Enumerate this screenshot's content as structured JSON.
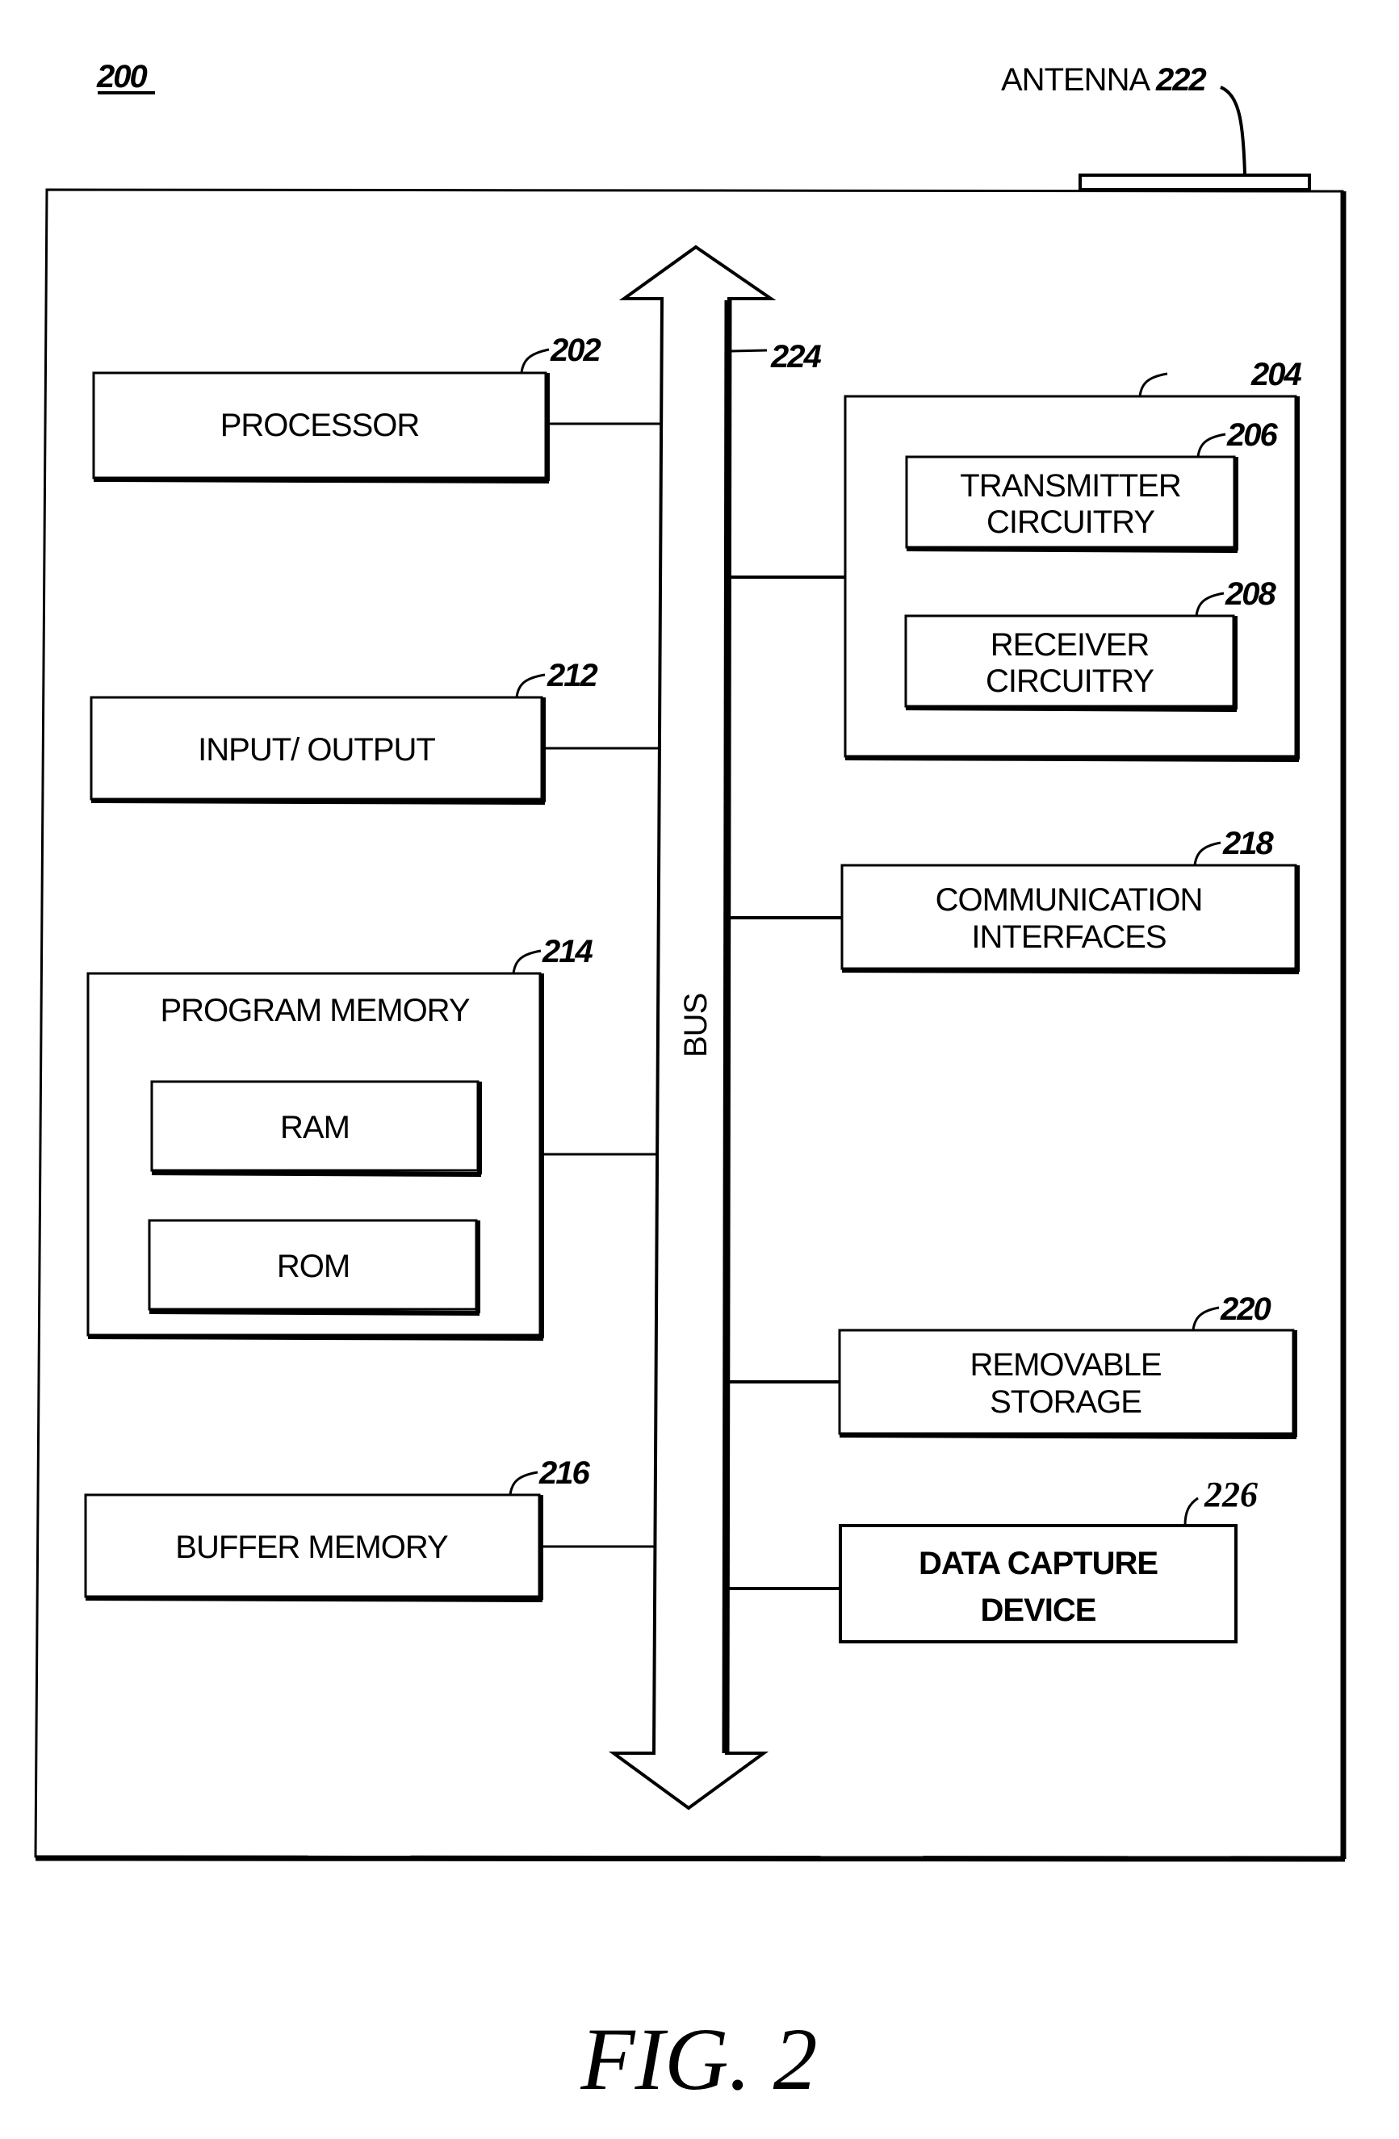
{
  "figure": {
    "number_label": "200",
    "caption": "FIG. 2",
    "colors": {
      "ink": "#000000",
      "paper": "#ffffff"
    }
  },
  "antenna": {
    "label": "ANTENNA",
    "ref": "222"
  },
  "bus": {
    "label": "BUS",
    "ref": "224"
  },
  "left_blocks": {
    "processor": {
      "label": "PROCESSOR",
      "ref": "202"
    },
    "input_output": {
      "label": "INPUT/ OUTPUT",
      "ref": "212"
    },
    "program_memory": {
      "label": "PROGRAM MEMORY",
      "ref": "214",
      "children": {
        "ram": {
          "label": "RAM"
        },
        "rom": {
          "label": "ROM"
        }
      }
    },
    "buffer_memory": {
      "label": "BUFFER MEMORY",
      "ref": "216"
    }
  },
  "right_blocks": {
    "transceiver": {
      "ref": "204",
      "children": {
        "transmitter": {
          "line1": "TRANSMITTER",
          "line2": "CIRCUITRY",
          "ref": "206"
        },
        "receiver": {
          "line1": "RECEIVER",
          "line2": "CIRCUITRY",
          "ref": "208"
        }
      }
    },
    "communication_interfaces": {
      "line1": "COMMUNICATION",
      "line2": "INTERFACES",
      "ref": "218"
    },
    "removable_storage": {
      "line1": "REMOVABLE",
      "line2": "STORAGE",
      "ref": "220"
    },
    "data_capture_device": {
      "line1": "DATA CAPTURE",
      "line2": "DEVICE",
      "ref": "226"
    }
  }
}
